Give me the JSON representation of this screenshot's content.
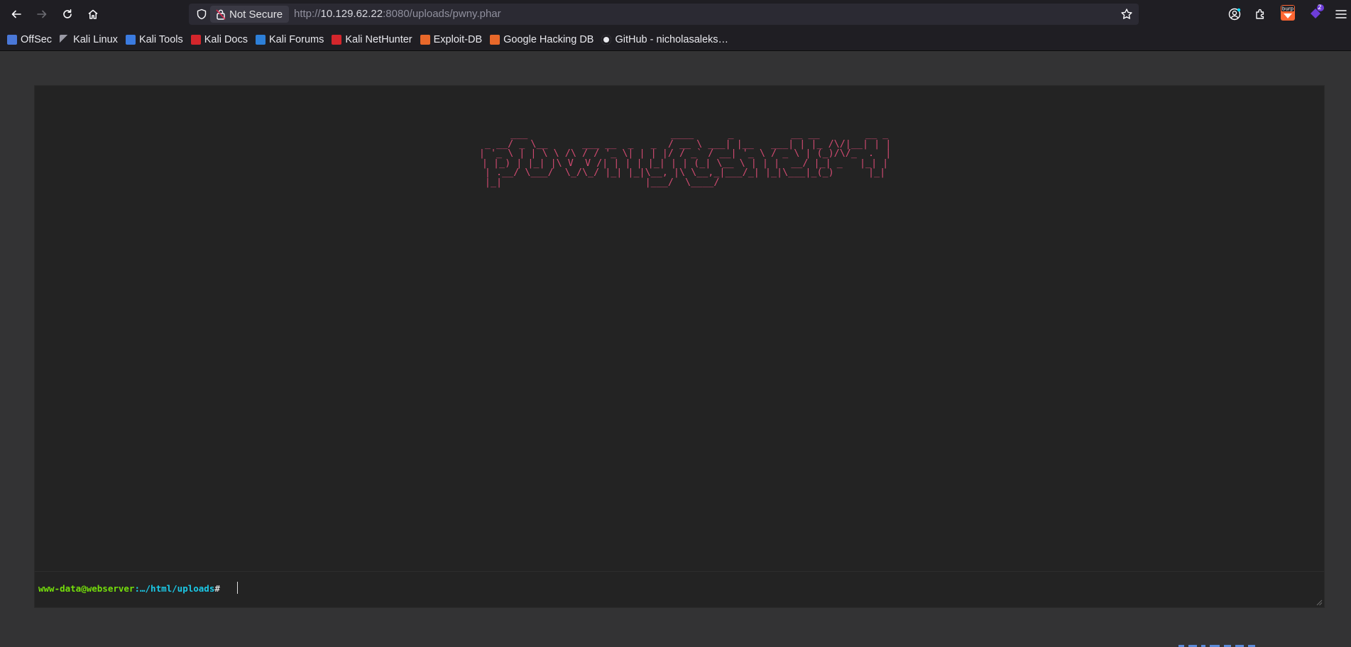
{
  "browser": {
    "url_scheme": "http://",
    "url_host": "10.129.62.22",
    "url_rest": ":8080/uploads/pwny.phar",
    "security_label": "Not Secure",
    "extension_badge": "2",
    "extension_burp_label": "burp"
  },
  "bookmarks": [
    {
      "label": "OffSec",
      "icon": "offsec-icon",
      "color": "#4a78d8"
    },
    {
      "label": "Kali Linux",
      "icon": "kali-dragon-icon",
      "color": "#9a9aa5"
    },
    {
      "label": "Kali Tools",
      "icon": "kali-tools-icon",
      "color": "#3b7be0"
    },
    {
      "label": "Kali Docs",
      "icon": "kali-docs-icon",
      "color": "#d4262c"
    },
    {
      "label": "Kali Forums",
      "icon": "kali-forums-icon",
      "color": "#2d7fd8"
    },
    {
      "label": "Kali NetHunter",
      "icon": "kali-nethunter-icon",
      "color": "#d4262c"
    },
    {
      "label": "Exploit-DB",
      "icon": "exploit-db-icon",
      "color": "#e8682a"
    },
    {
      "label": "Google Hacking DB",
      "icon": "ghdb-icon",
      "color": "#e8682a"
    },
    {
      "label": "GitHub - nicholasaleks…",
      "icon": "github-icon",
      "color": "#e9e9ee"
    }
  ],
  "shell": {
    "banner": "        ___                         ____      _          __ __        __ _ \n   _ __/ _ \\__      ___ __  _   _  / __ \\ ___| |__   ___| | |_ /\\/|__| | |\n  | '_ \\ | | \\ \\ /\\ / / '_ \\| | | |/ / _` / __| '_ \\ / _ \\ | (_)/\\/_  .  |\n  | |_) | |_| |\\ V  V /| | | | |_| | | (_| \\__ \\ | | |  __/ |_| _   |_| |\n  | .__/ \\___/  \\_/\\_/ |_| |_|\\__, |\\ \\__,_|___/_| |_|\\___|_(_)      |_|\n  |_|                         |___/  \\____/                             ",
    "prompt_user": "www-data@webserver",
    "prompt_path": ":…/html/uploads",
    "prompt_hash": "#",
    "command": ""
  },
  "colors": {
    "banner": "#d24a71",
    "prompt_user": "#75df0b",
    "prompt_path": "#1bc9e7",
    "terminal_bg": "#232323",
    "page_bg": "#333334"
  }
}
